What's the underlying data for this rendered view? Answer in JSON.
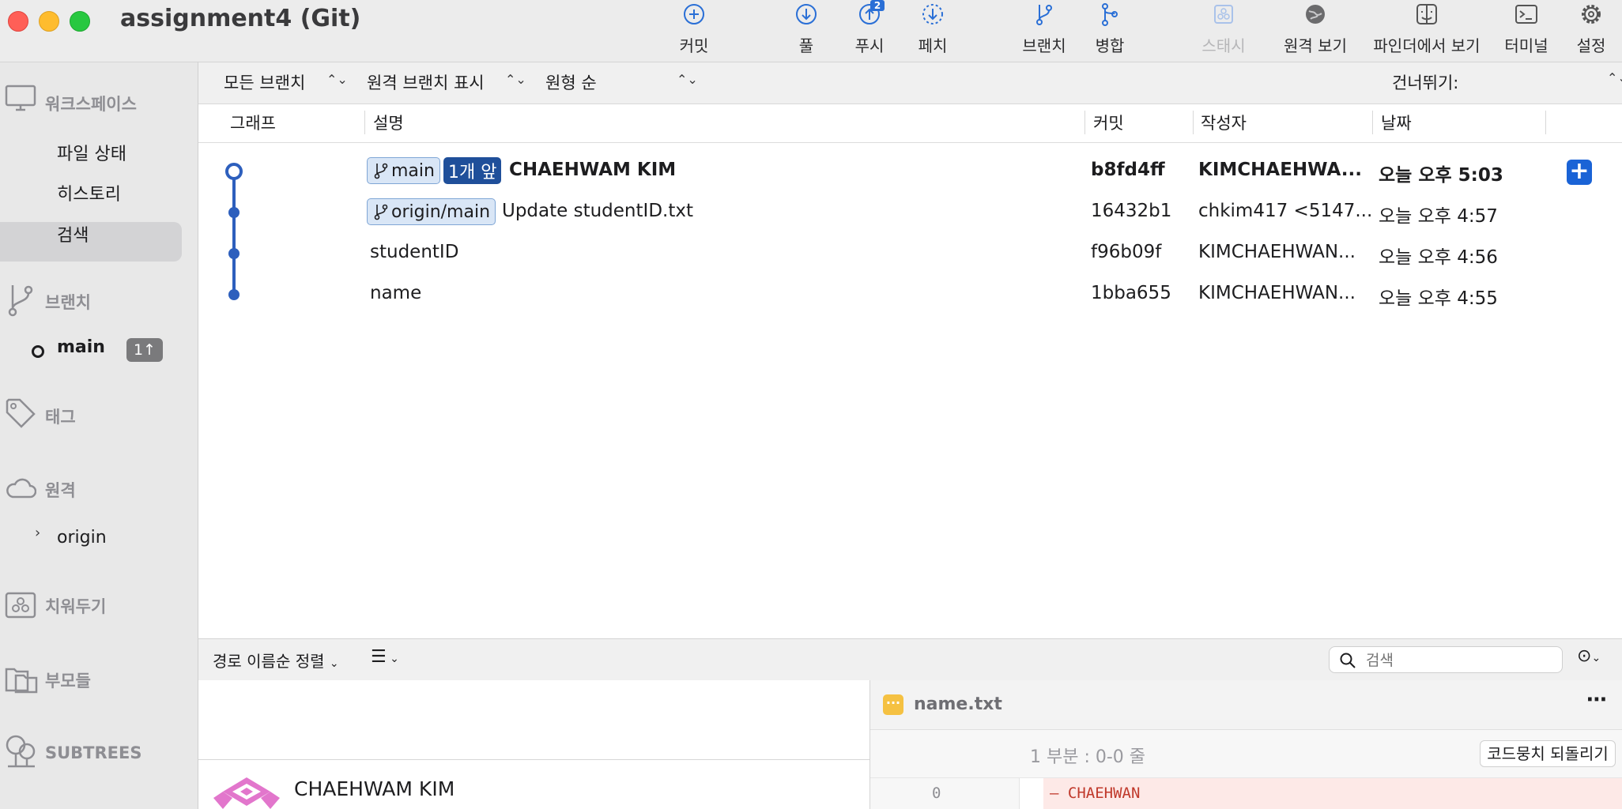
{
  "window": {
    "title": "assignment4 (Git)"
  },
  "toolbar": {
    "commit": "커밋",
    "pull": "풀",
    "push": "푸시",
    "push_badge": "2",
    "fetch": "페치",
    "branch": "브랜치",
    "merge": "병합",
    "stash": "스태시",
    "remote_view": "원격 보기",
    "finder_view": "파인더에서 보기",
    "terminal": "터미널",
    "settings": "설정"
  },
  "sidebar": {
    "workspace": "워크스페이스",
    "file_status": "파일 상태",
    "history": "히스토리",
    "search": "검색",
    "branches": "브랜치",
    "branch_main": "main",
    "branch_main_badge": "1↑",
    "tags": "태그",
    "remotes": "원격",
    "remote_origin": "origin",
    "stashes": "치워두기",
    "parents": "부모들",
    "subtrees": "SUBTREES"
  },
  "filters": {
    "branches": "모든 브랜치",
    "remote_branches": "원격 브랜치 표시",
    "order": "원형 순",
    "jump": "건너뛰기:"
  },
  "columns": {
    "graph": "그래프",
    "description": "설명",
    "commit": "커밋",
    "author": "작성자",
    "date": "날짜"
  },
  "commits": [
    {
      "branch": "main",
      "ahead": "1개 앞",
      "message": "CHAEHWAM KIM",
      "hash": "b8fd4ff",
      "author": "KIMCHAEHWA...",
      "date": "오늘 오후 5:03"
    },
    {
      "branch": "origin/main",
      "message": "Update studentID.txt",
      "hash": "16432b1",
      "author": "chkim417 <5147...",
      "date": "오늘 오후 4:57"
    },
    {
      "message": "studentID",
      "hash": "f96b09f",
      "author": "KIMCHAEHWAN...",
      "date": "오늘 오후 4:56"
    },
    {
      "message": "name",
      "hash": "1bba655",
      "author": "KIMCHAEHWAN...",
      "date": "오늘 오후 4:55"
    }
  ],
  "details": {
    "sort": "경로 이름순 정렬",
    "search_placeholder": "검색",
    "author_name": "CHAEHWAM KIM",
    "file_name": "name.txt",
    "hunk_label": "1 부분 : 0-0 줄",
    "revert_hunk": "코드뭉치 되돌리기",
    "diff_line_number": "0",
    "diff_line_text": "– CHAEHWAN"
  },
  "colors": {
    "accent": "#1a63d6",
    "graph": "#2d5fbd",
    "ahead_badge": "#1f4f9a",
    "removed_bg": "#fde9e7",
    "removed_text": "#c0392b"
  }
}
